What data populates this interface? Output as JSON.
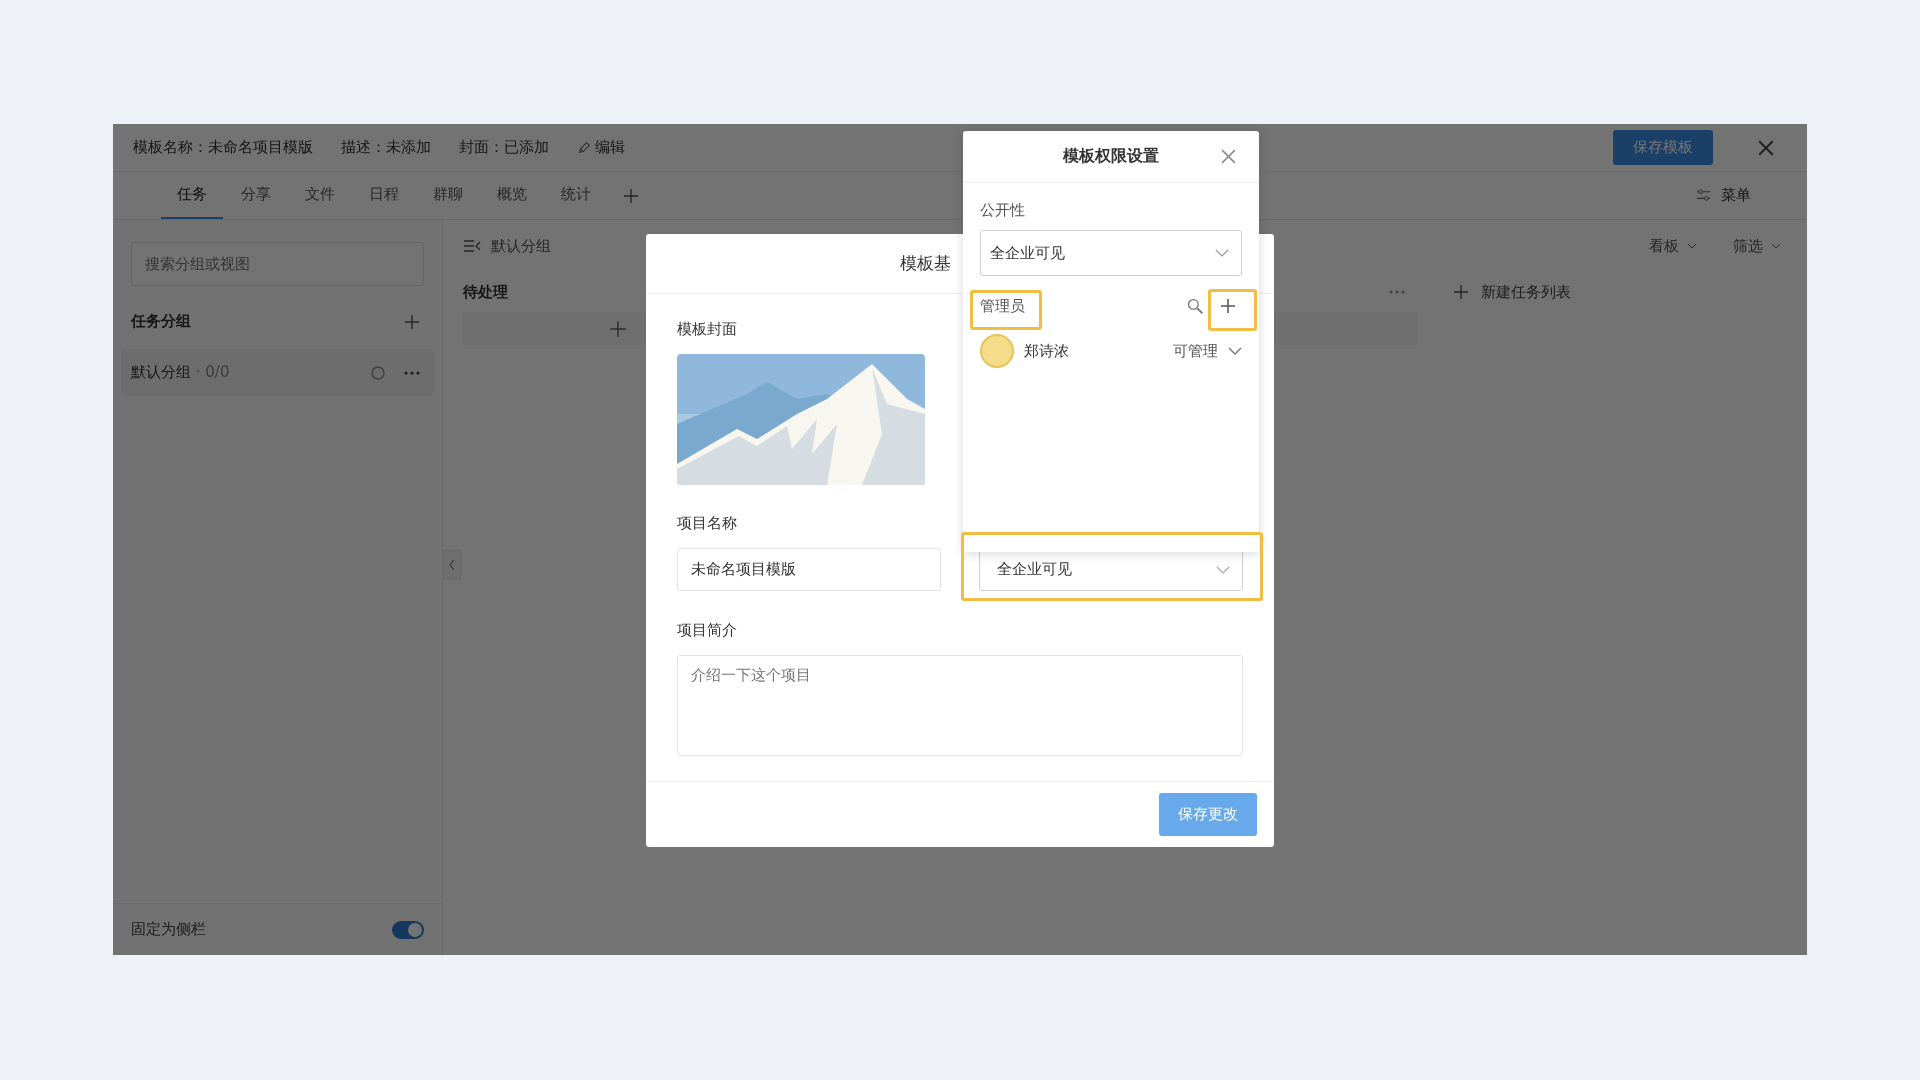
{
  "header": {
    "fields": [
      {
        "label": "模板名称：",
        "value": "未命名项目模版"
      },
      {
        "label": "描述：",
        "value": "未添加"
      },
      {
        "label": "封面：",
        "value": "已添加"
      }
    ],
    "edit": "编辑",
    "save_button": "保存模板"
  },
  "tabs": [
    {
      "label": "任务",
      "selected": true
    },
    {
      "label": "分享",
      "selected": false
    },
    {
      "label": "文件",
      "selected": false
    },
    {
      "label": "日程",
      "selected": false
    },
    {
      "label": "群聊",
      "selected": false
    },
    {
      "label": "概览",
      "selected": false
    },
    {
      "label": "统计",
      "selected": false
    }
  ],
  "menu": "菜单",
  "sidebar": {
    "search_placeholder": "搜索分组或视图",
    "section": "任务分组",
    "groups": [
      {
        "name": "默认分组",
        "count": "· 0/0"
      }
    ],
    "pin_label": "固定为侧栏",
    "pin_on": true
  },
  "board": {
    "breadcrumb": "默认分组",
    "view": "看板",
    "filter": "筛选",
    "columns": [
      {
        "title": "待处理"
      }
    ],
    "new_list": "新建任务列表"
  },
  "basic_dialog": {
    "title": "模板基",
    "cover_label": "模板封面",
    "name_label": "项目名称",
    "name_value": "未命名项目模版",
    "visibility_value": "全企业可见",
    "intro_label": "项目简介",
    "intro_placeholder": "介绍一下这个项目",
    "save_button": "保存更改"
  },
  "permission_dialog": {
    "title": "模板权限设置",
    "visibility_label": "公开性",
    "visibility_value": "全企业可见",
    "admins_label": "管理员",
    "members": [
      {
        "name": "郑诗浓",
        "role": "可管理"
      }
    ]
  }
}
